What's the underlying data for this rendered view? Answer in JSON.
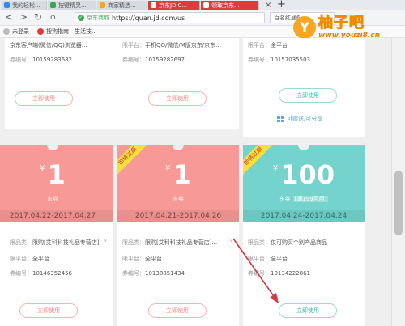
{
  "browser": {
    "tabs": [
      {
        "title": "我的轻松...",
        "color": "#2d8cf0"
      },
      {
        "title": "按键精灵...",
        "color": "#3aa655"
      },
      {
        "title": "商家精选...",
        "color": "#f5a623"
      },
      {
        "title": "京东JD.C...",
        "color": "#e4393c"
      },
      {
        "title": "领取京东...",
        "color": "#e4393c"
      }
    ],
    "close_glyph": "×",
    "new_tab_glyph": "+",
    "site_name": "京东商城",
    "url": "https://quan.jd.com/us",
    "search_text": "百名红通6",
    "bookmarks": [
      "未登录",
      "搜狗指南—生活技..."
    ]
  },
  "watermark": {
    "letter": "Y",
    "name": "柚子吧",
    "url": "www.youzi8.cn"
  },
  "top_cards": [
    {
      "platform_value": "京东客户端(微信/QQ)浏览器...",
      "id_label": "券编号：",
      "id_value": "10159283682",
      "button": "立即使用",
      "style": "pink"
    },
    {
      "platform_label": "限平台：",
      "platform_value": "手机QQ/微信/M版京东/京东...",
      "id_label": "券编号：",
      "id_value": "10159282697",
      "button": "立即使用",
      "style": "pink"
    },
    {
      "platform_label": "限平台：",
      "platform_value": "全平台",
      "id_label": "券编号：",
      "id_value": "10157035503",
      "button": "立即使用",
      "style": "teal",
      "share": "可赠送/可分享"
    }
  ],
  "coupons": [
    {
      "currency": "¥",
      "amount": "1",
      "type": "东券",
      "limit": "",
      "dates": "2017.04.22-2017.04.27",
      "color": "#f79a97",
      "ribbon": "",
      "product_label": "限品类：",
      "product_value": "限购[艾科科技礼品专营店]...",
      "platform_label": "限平台：",
      "platform_value": "全平台",
      "id_label": "券编号：",
      "id_value": "10146352456",
      "button": "立即使用",
      "style": "pink"
    },
    {
      "currency": "¥",
      "amount": "1",
      "type": "东券",
      "limit": "",
      "dates": "2017.04.21-2017.04.26",
      "color": "#f79a97",
      "ribbon": "即将过期",
      "product_label": "限品类：",
      "product_value": "限购[艾科科技礼品专营店]...",
      "platform_label": "限平台：",
      "platform_value": "全平台",
      "id_label": "券编号：",
      "id_value": "10138851434",
      "button": "立即使用",
      "style": "pink"
    },
    {
      "currency": "¥",
      "amount": "100",
      "type": "东券",
      "limit": "满199可用",
      "dates": "2017.04.24-2017.04.24",
      "color": "#74d3cd",
      "ribbon": "即将过期",
      "product_label": "限品类：",
      "product_value": "仅可购买个别产品商品",
      "platform_label": "限平台：",
      "platform_value": "全平台",
      "id_label": "券编号：",
      "id_value": "10134222861",
      "button": "立即使用",
      "style": "teal"
    }
  ],
  "colors": {
    "pink": "#f79a97",
    "teal": "#74d3cd",
    "arrow": "#d9363e",
    "jd_red": "#e4393c"
  }
}
